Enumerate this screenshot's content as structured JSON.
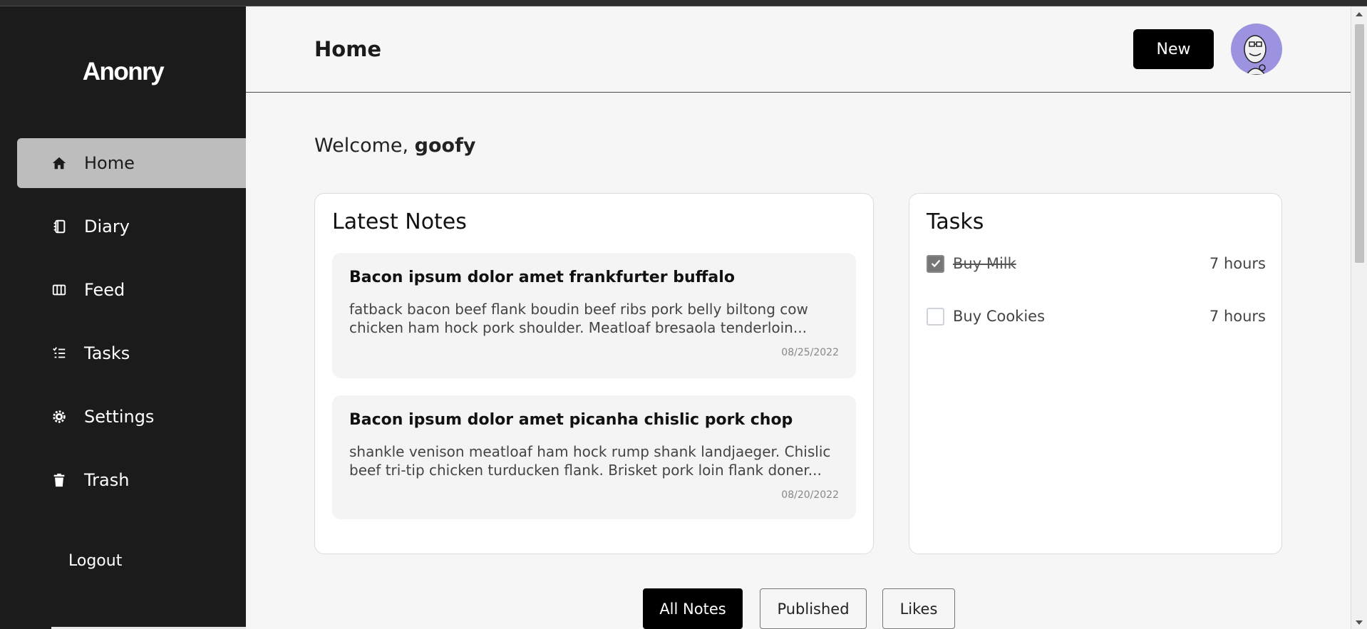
{
  "app": {
    "name": "Anonry"
  },
  "sidebar": {
    "items": [
      {
        "label": "Home",
        "icon": "home-icon",
        "active": true
      },
      {
        "label": "Diary",
        "icon": "diary-icon",
        "active": false
      },
      {
        "label": "Feed",
        "icon": "feed-icon",
        "active": false
      },
      {
        "label": "Tasks",
        "icon": "tasks-icon",
        "active": false
      },
      {
        "label": "Settings",
        "icon": "settings-icon",
        "active": false
      },
      {
        "label": "Trash",
        "icon": "trash-icon",
        "active": false
      }
    ],
    "logout_label": "Logout"
  },
  "header": {
    "title": "Home",
    "new_label": "New",
    "avatar": "avatar-icon"
  },
  "welcome": {
    "prefix": "Welcome, ",
    "username": "goofy"
  },
  "latest_notes": {
    "title": "Latest Notes",
    "notes": [
      {
        "title": "Bacon ipsum dolor amet frankfurter buffalo",
        "body": "fatback bacon beef flank boudin beef ribs pork belly biltong cow chicken ham hock pork shoulder. Meatloaf bresaola tenderloin...",
        "date": "08/25/2022"
      },
      {
        "title": "Bacon ipsum dolor amet picanha chislic pork chop",
        "body": "shankle venison meatloaf ham hock rump shank landjaeger. Chislic beef tri-tip chicken turducken flank. Brisket pork loin flank doner...",
        "date": "08/20/2022"
      }
    ]
  },
  "tasks": {
    "title": "Tasks",
    "items": [
      {
        "label": "Buy Milk",
        "time": "7 hours",
        "done": true
      },
      {
        "label": "Buy Cookies",
        "time": "7 hours",
        "done": false
      }
    ]
  },
  "filter_tabs": [
    {
      "label": "All Notes",
      "active": true
    },
    {
      "label": "Published",
      "active": false
    },
    {
      "label": "Likes",
      "active": false
    }
  ],
  "colors": {
    "sidebar_bg": "#1b1b1b",
    "active_nav_bg": "#bdbdbd",
    "main_bg": "#f6f6f6",
    "avatar_bg": "#9b93e0",
    "primary_button": "#000000"
  }
}
